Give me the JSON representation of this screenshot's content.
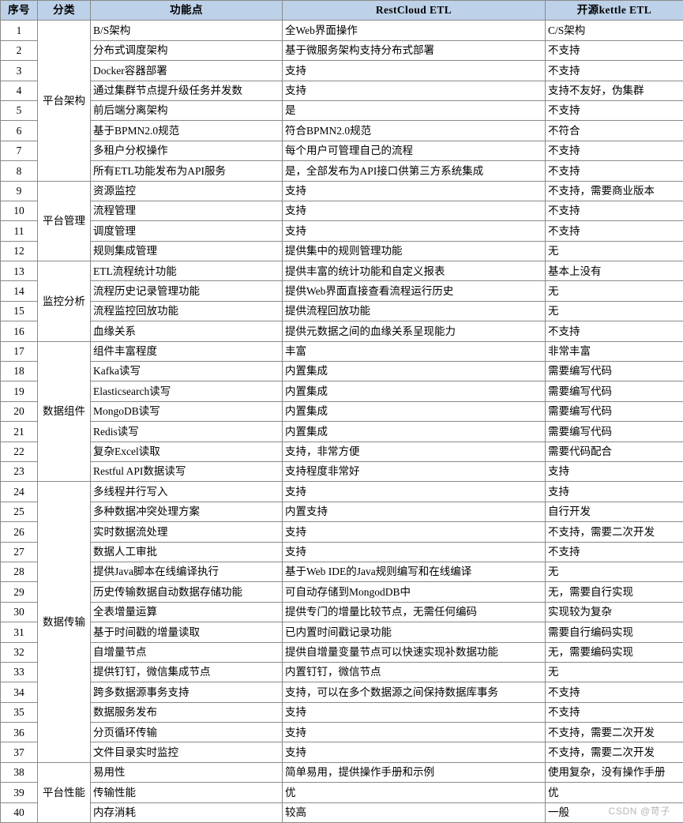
{
  "table": {
    "headers": {
      "index": "序号",
      "category": "分类",
      "feature": "功能点",
      "restcloud": "RestCloud ETL",
      "kettle": "开源kettle ETL"
    },
    "categories": [
      {
        "name": "平台架构",
        "span": 8
      },
      {
        "name": "平台管理",
        "span": 4
      },
      {
        "name": "监控分析",
        "span": 4
      },
      {
        "name": "数据组件",
        "span": 7
      },
      {
        "name": "数据传输",
        "span": 14
      },
      {
        "name": "平台性能",
        "span": 3
      }
    ],
    "rows": [
      {
        "index": "1",
        "feature": "B/S架构",
        "restcloud": "全Web界面操作",
        "kettle": "C/S架构"
      },
      {
        "index": "2",
        "feature": "分布式调度架构",
        "restcloud": "基于微服务架构支持分布式部署",
        "kettle": "不支持"
      },
      {
        "index": "3",
        "feature": "Docker容器部署",
        "restcloud": "支持",
        "kettle": "不支持"
      },
      {
        "index": "4",
        "feature": "通过集群节点提升级任务并发数",
        "restcloud": "支持",
        "kettle": "支持不友好，伪集群"
      },
      {
        "index": "5",
        "feature": "前后端分离架构",
        "restcloud": "是",
        "kettle": "不支持"
      },
      {
        "index": "6",
        "feature": "基于BPMN2.0规范",
        "restcloud": "符合BPMN2.0规范",
        "kettle": "不符合"
      },
      {
        "index": "7",
        "feature": "多租户分权操作",
        "restcloud": "每个用户可管理自己的流程",
        "kettle": "不支持"
      },
      {
        "index": "8",
        "feature": "所有ETL功能发布为API服务",
        "restcloud": "是，全部发布为API接口供第三方系统集成",
        "kettle": "不支持"
      },
      {
        "index": "9",
        "feature": "资源监控",
        "restcloud": "支持",
        "kettle": "不支持，需要商业版本"
      },
      {
        "index": "10",
        "feature": "流程管理",
        "restcloud": "支持",
        "kettle": "不支持"
      },
      {
        "index": "11",
        "feature": "调度管理",
        "restcloud": "支持",
        "kettle": "不支持"
      },
      {
        "index": "12",
        "feature": "规则集成管理",
        "restcloud": "提供集中的规则管理功能",
        "kettle": "无"
      },
      {
        "index": "13",
        "feature": "ETL流程统计功能",
        "restcloud": "提供丰富的统计功能和自定义报表",
        "kettle": "基本上没有"
      },
      {
        "index": "14",
        "feature": "流程历史记录管理功能",
        "restcloud": "提供Web界面直接查看流程运行历史",
        "kettle": "无"
      },
      {
        "index": "15",
        "feature": "流程监控回放功能",
        "restcloud": "提供流程回放功能",
        "kettle": "无"
      },
      {
        "index": "16",
        "feature": "血缘关系",
        "restcloud": "提供元数据之间的血缘关系呈现能力",
        "kettle": "不支持"
      },
      {
        "index": "17",
        "feature": "组件丰富程度",
        "restcloud": "丰富",
        "kettle": "非常丰富"
      },
      {
        "index": "18",
        "feature": "Kafka读写",
        "restcloud": "内置集成",
        "kettle": "需要编写代码"
      },
      {
        "index": "19",
        "feature": "Elasticsearch读写",
        "restcloud": "内置集成",
        "kettle": "需要编写代码"
      },
      {
        "index": "20",
        "feature": "MongoDB读写",
        "restcloud": "内置集成",
        "kettle": "需要编写代码"
      },
      {
        "index": "21",
        "feature": "Redis读写",
        "restcloud": "内置集成",
        "kettle": "需要编写代码"
      },
      {
        "index": "22",
        "feature": "复杂Excel读取",
        "restcloud": "支持，非常方便",
        "kettle": "需要代码配合"
      },
      {
        "index": "23",
        "feature": "Restful API数据读写",
        "restcloud": "支持程度非常好",
        "kettle": "支持"
      },
      {
        "index": "24",
        "feature": "多线程并行写入",
        "restcloud": "支持",
        "kettle": "支持"
      },
      {
        "index": "25",
        "feature": "多种数据冲突处理方案",
        "restcloud": "内置支持",
        "kettle": "自行开发"
      },
      {
        "index": "26",
        "feature": "实时数据流处理",
        "restcloud": "支持",
        "kettle": "不支持，需要二次开发"
      },
      {
        "index": "27",
        "feature": "数据人工审批",
        "restcloud": "支持",
        "kettle": "不支持"
      },
      {
        "index": "28",
        "feature": "提供Java脚本在线编译执行",
        "restcloud": "基于Web IDE的Java规则编写和在线编译",
        "kettle": "无"
      },
      {
        "index": "29",
        "feature": "历史传输数据自动数据存储功能",
        "restcloud": "可自动存储到MongodDB中",
        "kettle": "无，需要自行实现"
      },
      {
        "index": "30",
        "feature": "全表增量运算",
        "restcloud": "提供专门的增量比较节点，无需任何编码",
        "kettle": "实现较为复杂"
      },
      {
        "index": "31",
        "feature": "基于时间戳的增量读取",
        "restcloud": "已内置时间戳记录功能",
        "kettle": "需要自行编码实现"
      },
      {
        "index": "32",
        "feature": "自增量节点",
        "restcloud": "提供自增量变量节点可以快速实现补数据功能",
        "kettle": "无，需要编码实现"
      },
      {
        "index": "33",
        "feature": "提供钉钉，微信集成节点",
        "restcloud": "内置钉钉，微信节点",
        "kettle": "无"
      },
      {
        "index": "34",
        "feature": "跨多数据源事务支持",
        "restcloud": "支持，可以在多个数据源之间保持数据库事务",
        "kettle": "不支持"
      },
      {
        "index": "35",
        "feature": "数据服务发布",
        "restcloud": "支持",
        "kettle": "不支持"
      },
      {
        "index": "36",
        "feature": "分页循环传输",
        "restcloud": "支持",
        "kettle": "不支持，需要二次开发"
      },
      {
        "index": "37",
        "feature": "文件目录实时监控",
        "restcloud": "支持",
        "kettle": "不支持，需要二次开发"
      },
      {
        "index": "38",
        "feature": "易用性",
        "restcloud": "简单易用，提供操作手册和示例",
        "kettle": "使用复杂，没有操作手册"
      },
      {
        "index": "39",
        "feature": "传输性能",
        "restcloud": "优",
        "kettle": "优"
      },
      {
        "index": "40",
        "feature": "内存消耗",
        "restcloud": "较高",
        "kettle": "一般"
      }
    ]
  },
  "watermark": {
    "text": "CSDN @苛子"
  },
  "colors": {
    "header_background": "#bdd1e8",
    "border": "#8a8a8a",
    "text": "#000000",
    "watermark": "#b6b6b6"
  }
}
